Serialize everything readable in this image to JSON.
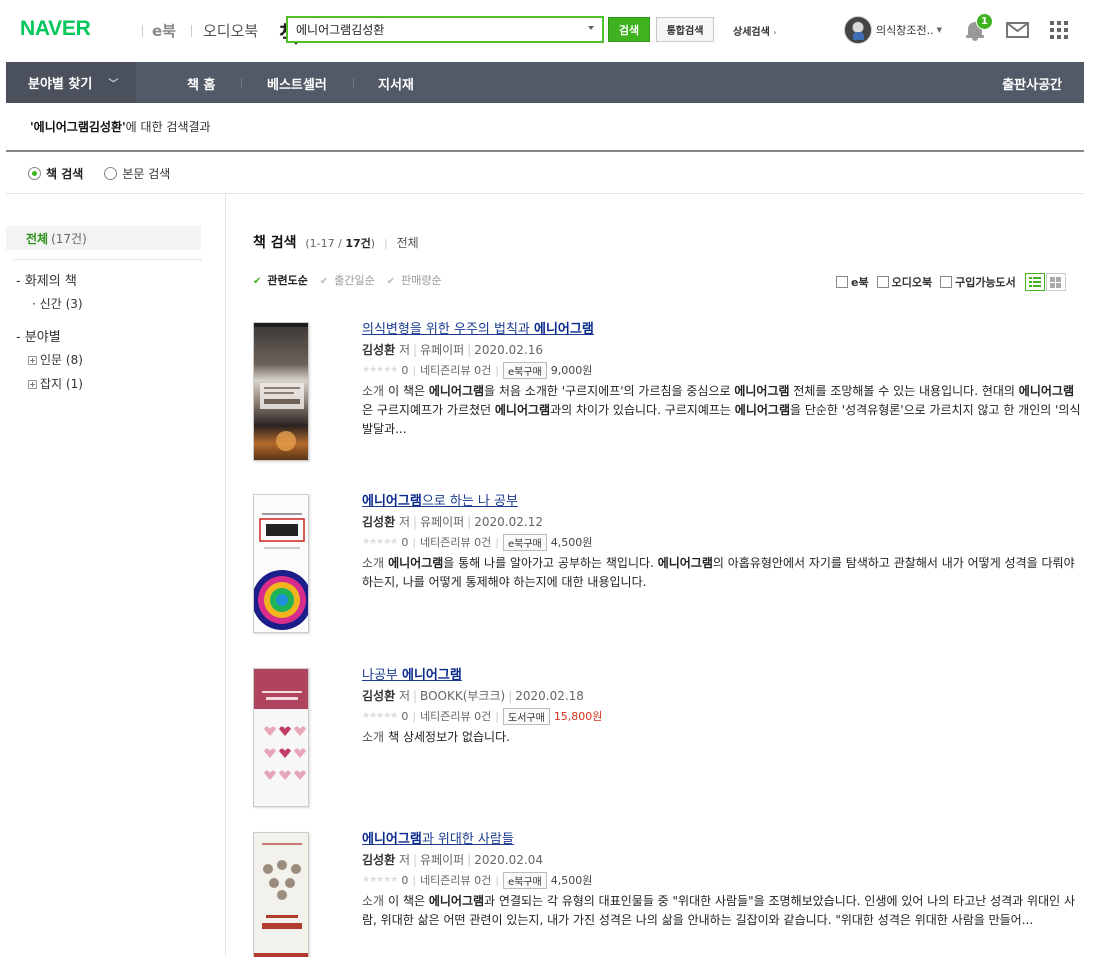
{
  "header": {
    "logo_naver": "NAVER",
    "logo_book": "책",
    "service_ebook": "e북",
    "service_audio": "오디오북",
    "search_value": "에니어그램김성환",
    "search_button": "검색",
    "total_search_button": "통합검색",
    "detail_search": "상세검색",
    "user_name": "의식창조전..",
    "notification_count": "1"
  },
  "nav": {
    "category": "분야별 찾기",
    "items": [
      "책 홈",
      "베스트셀러",
      "지서재"
    ],
    "publisher": "출판사공간"
  },
  "result": {
    "query": "'에니어그램김성환'",
    "suffix": "에 대한 검색결과",
    "radio_book": "책 검색",
    "radio_body": "본문 검색"
  },
  "sidebar": {
    "all_label": "전체",
    "all_count": "(17건)",
    "topic_head": "화제의 책",
    "topic_new": "신간",
    "topic_new_count": "(3)",
    "field_head": "분야별",
    "field_humanities": "인문",
    "field_humanities_count": "(8)",
    "field_magazine": "잡지",
    "field_magazine_count": "(1)"
  },
  "list": {
    "title": "책 검색",
    "range_prefix": "(1-17 / ",
    "range_bold": "17건",
    "range_suffix": ")",
    "scope": "전체",
    "sort": [
      "관련도순",
      "출간일순",
      "판매량순"
    ],
    "filters": [
      "e북",
      "오디오북",
      "구입가능도서"
    ]
  },
  "books": [
    {
      "title_pre": "의식변형을 위한 우주의 법칙과 ",
      "title_bold": "에니어그램",
      "title_post": "",
      "author": "김성환",
      "author_suffix": "저",
      "publisher": "유페이퍼",
      "date": "2020.02.16",
      "rating": "0",
      "review": "네티즌리뷰 0건",
      "buy_label": "e북구매",
      "price": "9,000원",
      "desc": [
        {
          "t": "소개",
          "c": "tag"
        },
        {
          "t": "이 책은 "
        },
        {
          "t": "에니어그램",
          "b": true
        },
        {
          "t": "을 처음 소개한 '구르지에프'의 가르침을 중심으로 "
        },
        {
          "t": "에니어그램",
          "b": true
        },
        {
          "t": " 전체를 조망해볼 수 있는 내용입니다. 현대의 "
        },
        {
          "t": "에니어그램",
          "b": true
        },
        {
          "t": "은 구르지예프가 가르쳤던 "
        },
        {
          "t": "에니어그램",
          "b": true
        },
        {
          "t": "과의 차이가 있습니다. 구르지예프는 "
        },
        {
          "t": "에니어그램",
          "b": true
        },
        {
          "t": "을 단순한 '성격유형론'으로 가르치지 않고 한 개인의 '의식발달과..."
        }
      ]
    },
    {
      "title_pre": "",
      "title_bold": "에니어그램",
      "title_post": "으로 하는 나 공부",
      "author": "김성환",
      "author_suffix": "저",
      "publisher": "유페이퍼",
      "date": "2020.02.12",
      "rating": "0",
      "review": "네티즌리뷰 0건",
      "buy_label": "e북구매",
      "price": "4,500원",
      "desc": [
        {
          "t": "소개",
          "c": "tag"
        },
        {
          "t": "에니어그램",
          "b": true
        },
        {
          "t": "을 통해 나를 알아가고 공부하는 책입니다. "
        },
        {
          "t": "에니어그램",
          "b": true
        },
        {
          "t": "의 아홉유형안에서 자기를 탐색하고 관찰해서 내가 어떻게 성격을 다뤄야 하는지, 나를 어떻게 통제해야 하는지에 대한 내용입니다."
        }
      ]
    },
    {
      "title_pre": "나공부 ",
      "title_bold": "에니어그램",
      "title_post": "",
      "author": "김성환",
      "author_suffix": "저",
      "publisher": "BOOKK(부크크)",
      "date": "2020.02.18",
      "rating": "0",
      "review": "네티즌리뷰 0건",
      "buy_label": "도서구매",
      "price": "15,800원",
      "price_red": true,
      "desc": [
        {
          "t": "소개",
          "c": "tag"
        },
        {
          "t": "책 상세정보가 없습니다."
        }
      ]
    },
    {
      "title_pre": "",
      "title_bold": "에니어그램",
      "title_post": "과 위대한 사람들",
      "author": "김성환",
      "author_suffix": "저",
      "publisher": "유페이퍼",
      "date": "2020.02.04",
      "rating": "0",
      "review": "네티즌리뷰 0건",
      "buy_label": "e북구매",
      "price": "4,500원",
      "desc": [
        {
          "t": "소개",
          "c": "tag"
        },
        {
          "t": "이 책은 "
        },
        {
          "t": "에니어그램",
          "b": true
        },
        {
          "t": "과 연결되는 각 유형의 대표인물들 중 \"위대한 사람들\"을 조명해보았습니다. 인생에 있어 나의 타고난 성격과 위대인 사람, 위대한 삶은 어떤 관련이 있는지, 내가 가진 성격은 나의 삶을 안내하는 길잡이와 같습니다. \"위대한 성격은 위대한 사람을 만들어..."
        }
      ]
    }
  ],
  "colors": {
    "brand_green": "#03c75a",
    "button_green": "#3fb21f",
    "nav_bg": "#535a67",
    "link_blue": "#1a3b8f",
    "price_red": "#d4331b"
  }
}
